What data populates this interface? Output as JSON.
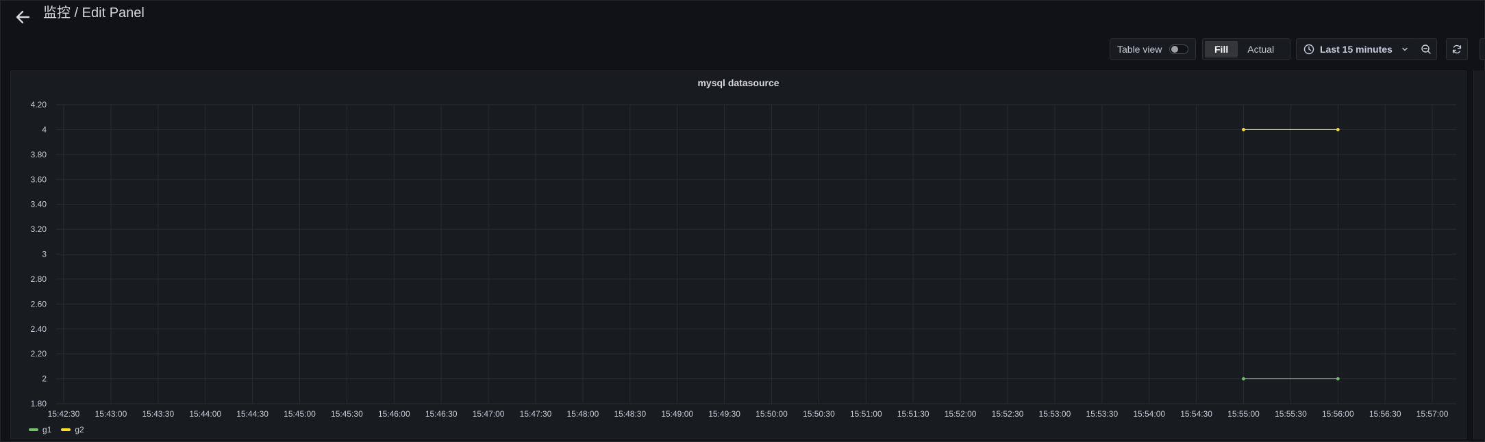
{
  "header": {
    "title": "监控 / Edit Panel"
  },
  "toolbar": {
    "table_view_label": "Table view",
    "fill_label": "Fill",
    "actual_label": "Actual",
    "time_range_label": "Last 15 minutes"
  },
  "panel": {
    "title": "mysql datasource"
  },
  "colors": {
    "g1": "#73bf69",
    "g2": "#fade2a"
  },
  "chart_data": {
    "type": "line",
    "title": "mysql datasource",
    "xlabel": "",
    "ylabel": "",
    "ylim": [
      1.8,
      4.2
    ],
    "yticks": [
      "4.20",
      "4",
      "3.80",
      "3.60",
      "3.40",
      "3.20",
      "3",
      "2.80",
      "2.60",
      "2.40",
      "2.20",
      "2",
      "1.80"
    ],
    "xticks": [
      "15:42:30",
      "15:43:00",
      "15:43:30",
      "15:44:00",
      "15:44:30",
      "15:45:00",
      "15:45:30",
      "15:46:00",
      "15:46:30",
      "15:47:00",
      "15:47:30",
      "15:48:00",
      "15:48:30",
      "15:49:00",
      "15:49:30",
      "15:50:00",
      "15:50:30",
      "15:51:00",
      "15:51:30",
      "15:52:00",
      "15:52:30",
      "15:53:00",
      "15:53:30",
      "15:54:00",
      "15:54:30",
      "15:55:00",
      "15:55:30",
      "15:56:00",
      "15:56:30",
      "15:57:00"
    ],
    "grid": true,
    "legend_position": "bottom-left",
    "series": [
      {
        "name": "g1",
        "color": "#73bf69",
        "x": [
          "15:55:00",
          "15:56:00"
        ],
        "values": [
          2,
          2
        ]
      },
      {
        "name": "g2",
        "color": "#fade2a",
        "x": [
          "15:55:00",
          "15:56:00"
        ],
        "values": [
          4,
          4
        ]
      }
    ]
  }
}
